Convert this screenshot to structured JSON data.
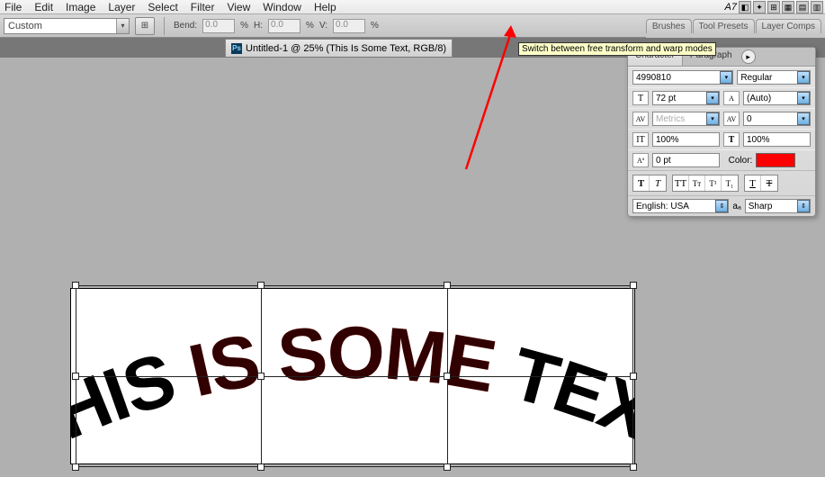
{
  "menu": {
    "file": "File",
    "edit": "Edit",
    "image": "Image",
    "layer": "Layer",
    "select": "Select",
    "filter": "Filter",
    "view": "View",
    "window": "Window",
    "help": "Help"
  },
  "options": {
    "style_label": "Custom",
    "bend": "Bend:",
    "bend_val": "0.0",
    "pct": "%",
    "h": "H:",
    "h_val": "0.0",
    "v": "V:",
    "v_val": "0.0"
  },
  "tooltip": "Switch between free transform and warp modes",
  "palette_tabs": {
    "brushes": "Brushes",
    "tool_presets": "Tool Presets",
    "layer_comps": "Layer Comps"
  },
  "doc_title": "Untitled-1 @ 25% (This Is Some Text, RGB/8)",
  "char": {
    "tab_character": "Character",
    "tab_paragraph": "Paragraph",
    "font": "4990810",
    "style": "Regular",
    "size": "72 pt",
    "leading": "(Auto)",
    "kerning": "Metrics",
    "tracking": "0",
    "vscale": "100%",
    "hscale": "100%",
    "baseline": "0 pt",
    "color_label": "Color:",
    "lang": "English: USA",
    "aa_label": "aₐ",
    "aa": "Sharp"
  },
  "text_content": "THIS IS SOME TEXT",
  "topright_label": "A7"
}
